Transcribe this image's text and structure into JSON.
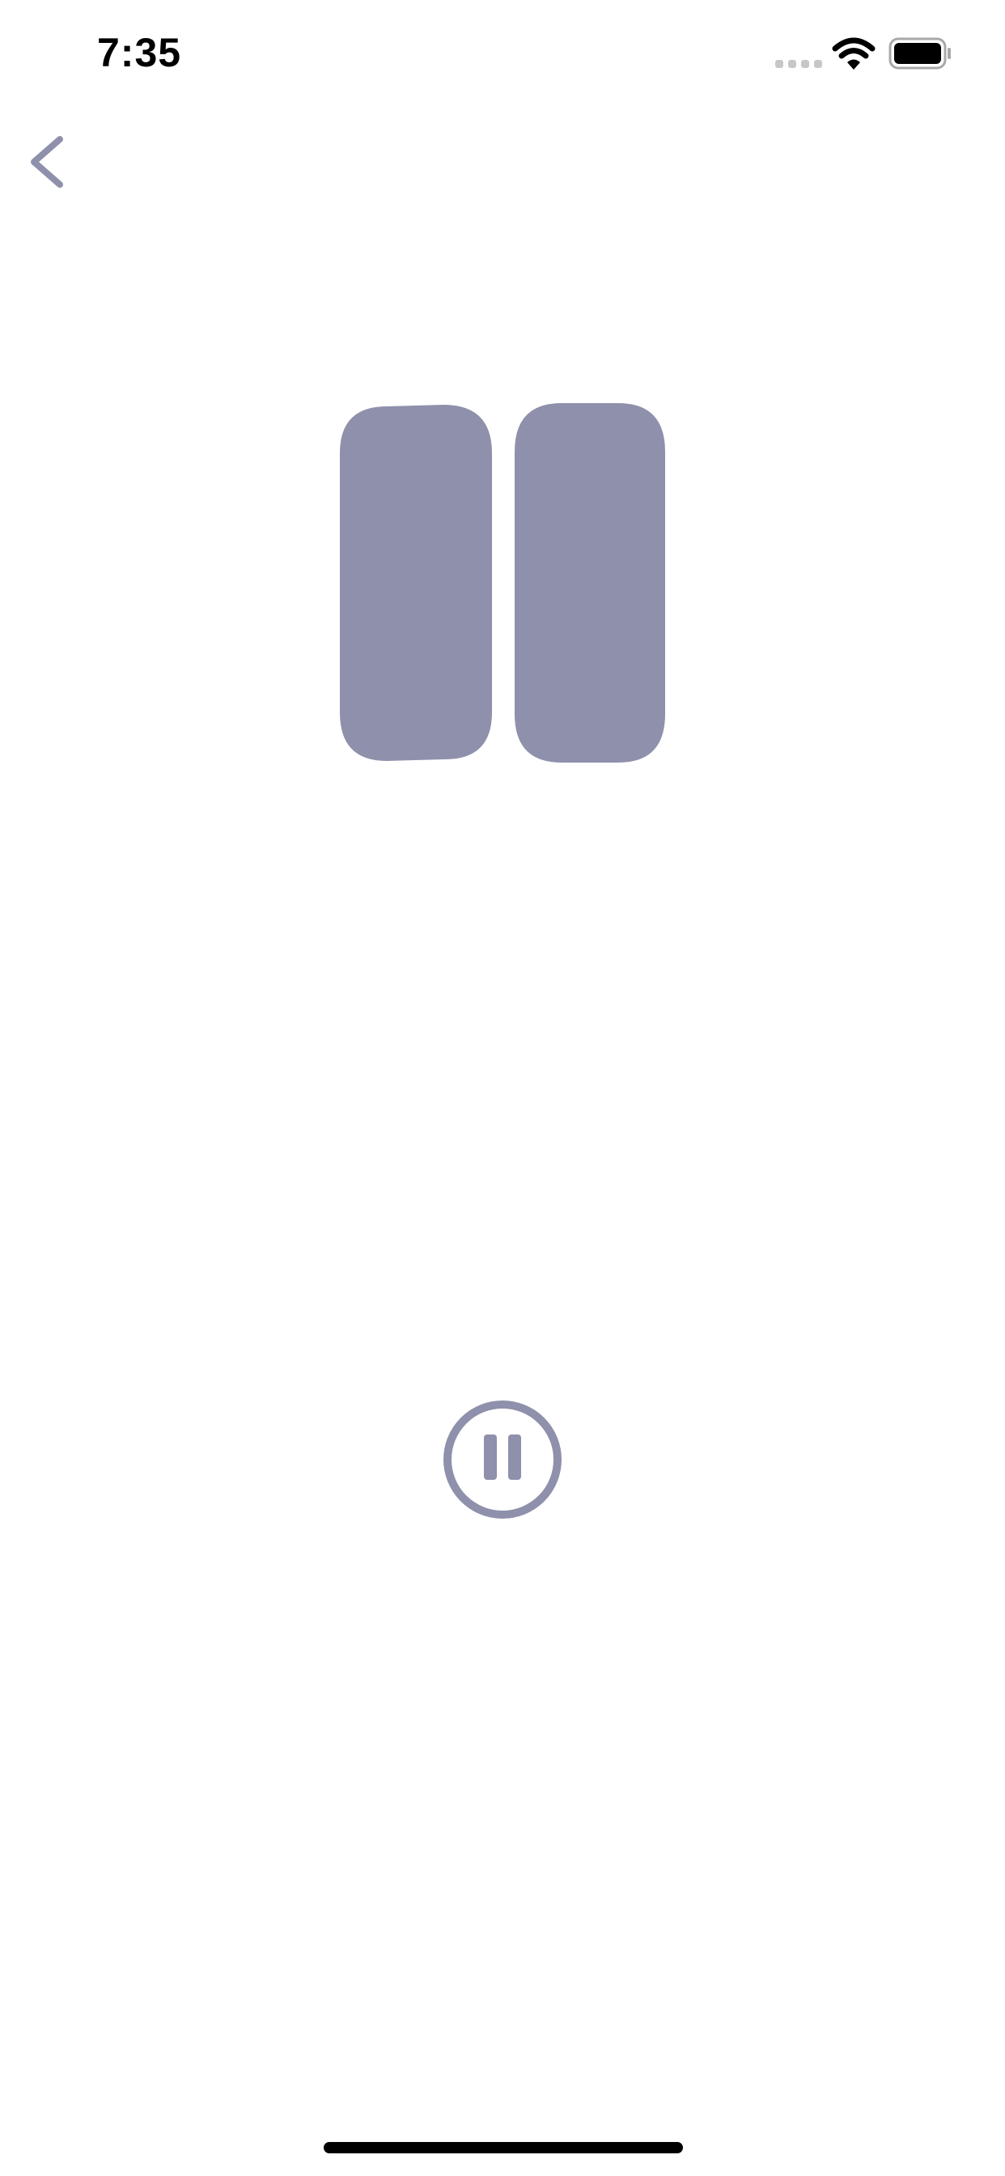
{
  "status_bar": {
    "time": "7:35",
    "icons": [
      "signal-icon",
      "wifi-icon",
      "battery-icon"
    ]
  },
  "navigation": {
    "back_icon": "chevron-left-icon"
  },
  "player": {
    "state_icon": "pause-icon",
    "control_icon": "pause-circle-icon"
  },
  "colors": {
    "accent": "#8f90ab",
    "background": "#ffffff",
    "status_text": "#000000",
    "inactive_signal": "#c7c7c7"
  }
}
